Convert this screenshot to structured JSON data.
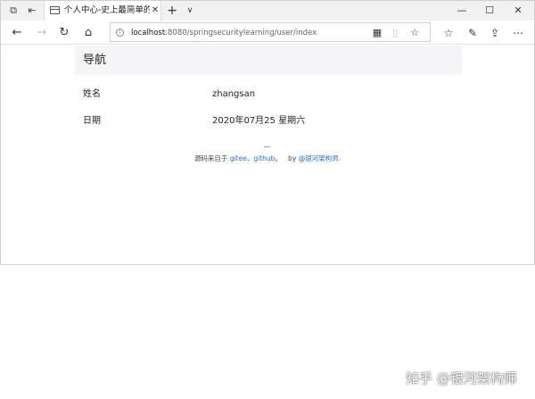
{
  "browser": {
    "tab": {
      "title": "个人中心-史上最简单的",
      "close_glyph": "✕"
    },
    "new_tab_glyph": "+",
    "tab_list_glyph": "∨",
    "window_controls": {
      "minimize": "—",
      "maximize": "☐",
      "close": "✕"
    },
    "address": {
      "host": "localhost",
      "path": ":8080/springsecuritylearning/user/index"
    },
    "icons": {
      "back": "←",
      "forward": "→",
      "refresh": "↻",
      "home": "⌂",
      "info": "i",
      "qr": "▦",
      "reading": "▯",
      "favorite": "☆",
      "favorites_hub": "☆",
      "notes": "✎",
      "share": "⇪",
      "more": "⋯"
    }
  },
  "page": {
    "nav_title": "导航",
    "rows": [
      {
        "label": "姓名",
        "value": "zhangsan"
      },
      {
        "label": "日期",
        "value": "2020年07月25 星期六"
      }
    ],
    "footer": {
      "prefix": "源码来自于 ",
      "gitee": "gitee",
      "sep1": "、",
      "github": "github",
      "sep2": "。   by ",
      "author": "@银河架构师",
      "suffix": "."
    }
  },
  "watermark": "知乎 @银河架构师"
}
